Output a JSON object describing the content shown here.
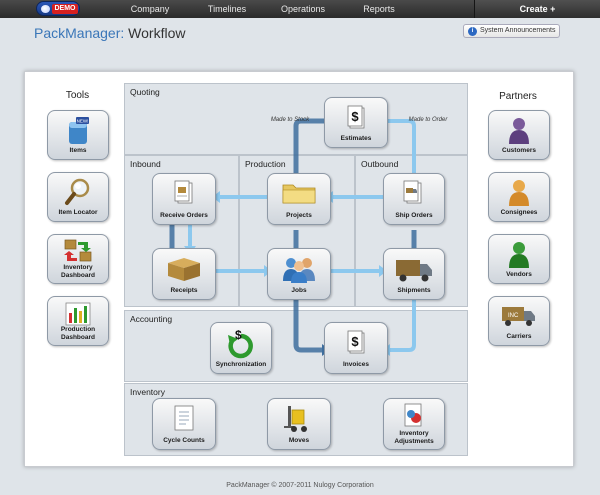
{
  "topbar": {
    "logo_tag": "DEMO",
    "nav": [
      "Company",
      "Timelines",
      "Operations",
      "Reports"
    ],
    "create_label": "Create +"
  },
  "header": {
    "app_name": "PackManager:",
    "page_name": "Workflow",
    "announcements_label": "System Announcements"
  },
  "tools": {
    "title": "Tools",
    "items": [
      {
        "label": "Items",
        "icon": "items-icon"
      },
      {
        "label": "Item Locator",
        "icon": "magnifier-icon"
      },
      {
        "label": "Inventory Dashboard",
        "icon": "inventory-dashboard-icon"
      },
      {
        "label": "Production Dashboard",
        "icon": "bar-chart-icon"
      }
    ]
  },
  "partners": {
    "title": "Partners",
    "items": [
      {
        "label": "Customers",
        "icon": "person-purple-icon"
      },
      {
        "label": "Consignees",
        "icon": "person-orange-icon"
      },
      {
        "label": "Vendors",
        "icon": "person-green-icon"
      },
      {
        "label": "Carriers",
        "icon": "truck-icon"
      }
    ]
  },
  "areas": {
    "quoting": "Quoting",
    "inbound": "Inbound",
    "production": "Production",
    "outbound": "Outbound",
    "accounting": "Accounting",
    "inventory": "Inventory"
  },
  "flow": {
    "estimates": "Estimates",
    "made_to_stock": "Made to Stock",
    "made_to_order": "Made to Order",
    "receive_orders": "Receive Orders",
    "projects": "Projects",
    "ship_orders": "Ship Orders",
    "receipts": "Receipts",
    "jobs": "Jobs",
    "shipments": "Shipments",
    "synchronization": "Synchronization",
    "invoices": "Invoices",
    "cycle_counts": "Cycle Counts",
    "moves": "Moves",
    "inventory_adjustments": "Inventory Adjustments"
  },
  "footer": "PackManager © 2007-2011 Nulogy Corporation",
  "colors": {
    "accent": "#3a76b8",
    "arrow_dark": "#3f6f9e",
    "arrow_light": "#8cc8ee",
    "logo_tag": "#d62020"
  }
}
